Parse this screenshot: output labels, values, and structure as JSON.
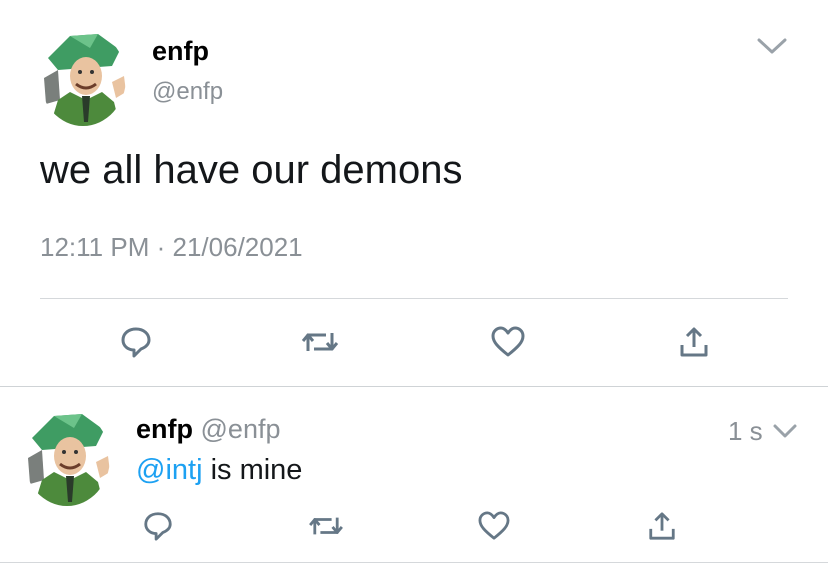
{
  "main_tweet": {
    "display_name": "enfp",
    "handle": "@enfp",
    "text": "we all have our demons",
    "time": "12:11 PM",
    "separator": "·",
    "date": "21/06/2021",
    "avatar_icon": "green-caricature-avatar"
  },
  "reply": {
    "display_name": "enfp",
    "handle": "@enfp",
    "age": "1 s",
    "mention": "@intj",
    "text_rest": " is mine",
    "avatar_icon": "green-caricature-avatar"
  },
  "actions": [
    "reply-icon",
    "retweet-icon",
    "like-icon",
    "share-icon"
  ],
  "colors": {
    "accent": "#1da1f2",
    "icon": "#657786",
    "muted": "#8a9096",
    "avatar_green": "#4fae6b"
  }
}
